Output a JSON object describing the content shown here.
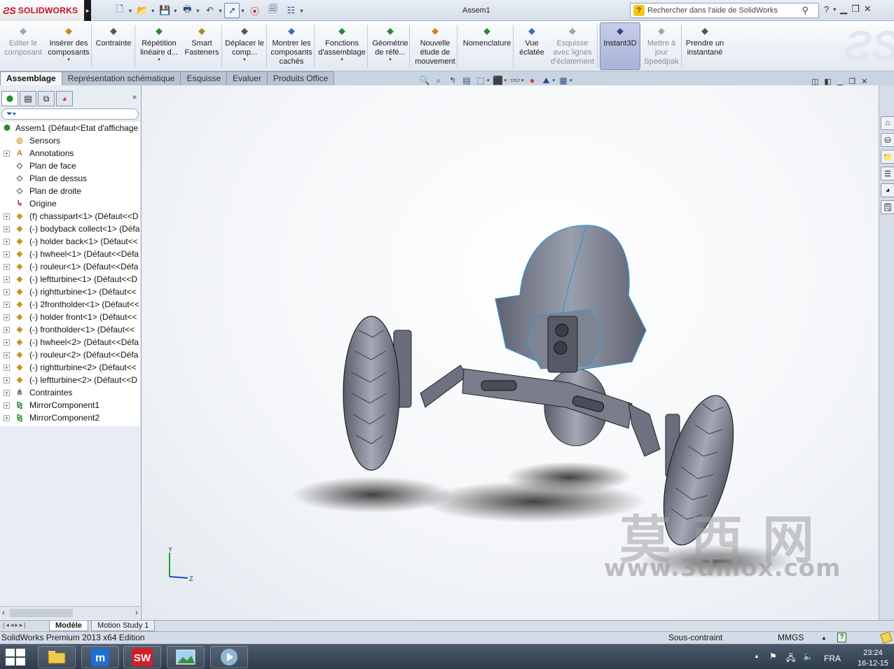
{
  "app": {
    "brand": "SOLIDWORKS",
    "doc_title": "Assem1",
    "search_placeholder": "Rechercher dans l'aide de SolidWorks"
  },
  "ribbon": {
    "items": [
      {
        "label": "Editer le composant",
        "icon": "edit-component-icon",
        "enabled": false
      },
      {
        "label": "Insérer des composants",
        "icon": "insert-components-icon",
        "enabled": true
      },
      {
        "label": "Contrainte",
        "icon": "mate-icon",
        "enabled": true
      },
      {
        "label": "Répétition linéaire d...",
        "icon": "linear-pattern-icon",
        "enabled": true
      },
      {
        "label": "Smart Fasteners",
        "icon": "smart-fasteners-icon",
        "enabled": true
      },
      {
        "label": "Déplacer le comp...",
        "icon": "move-component-icon",
        "enabled": true
      },
      {
        "label": "Montrer les composants cachés",
        "icon": "show-hidden-icon",
        "enabled": true
      },
      {
        "label": "Fonctions d'assemblage",
        "icon": "assembly-features-icon",
        "enabled": true
      },
      {
        "label": "Géométrie de réfé...",
        "icon": "reference-geometry-icon",
        "enabled": true
      },
      {
        "label": "Nouvelle étude de mouvement",
        "icon": "motion-study-icon",
        "enabled": true
      },
      {
        "label": "Nomenclature",
        "icon": "bom-icon",
        "enabled": true
      },
      {
        "label": "Vue éclatée",
        "icon": "exploded-view-icon",
        "enabled": true
      },
      {
        "label": "Esquisse avec lignes d'éclatement",
        "icon": "explode-line-sketch-icon",
        "enabled": false
      },
      {
        "label": "Instant3D",
        "icon": "instant3d-icon",
        "enabled": true,
        "active": true
      },
      {
        "label": "Mettre à jour Speedpak",
        "icon": "speedpak-icon",
        "enabled": false
      },
      {
        "label": "Prendre un instantané",
        "icon": "snapshot-icon",
        "enabled": true
      }
    ]
  },
  "command_tabs": [
    "Assemblage",
    "Représentation schématique",
    "Esquisse",
    "Evaluer",
    "Produits Office"
  ],
  "tree": {
    "root": "Assem1  (Défaut<Etat d'affichage",
    "items": [
      {
        "label": "Sensors",
        "icon": "sensor-icon",
        "expandable": false
      },
      {
        "label": "Annotations",
        "icon": "annotations-icon",
        "expandable": true
      },
      {
        "label": "Plan de face",
        "icon": "plane-icon",
        "expandable": false
      },
      {
        "label": "Plan de dessus",
        "icon": "plane-icon",
        "expandable": false
      },
      {
        "label": "Plan de droite",
        "icon": "plane-icon",
        "expandable": false
      },
      {
        "label": "Origine",
        "icon": "origin-icon",
        "expandable": false
      },
      {
        "label": "(f) chassipart<1> (Défaut<<D",
        "icon": "part-icon",
        "expandable": true
      },
      {
        "label": "(-) bodyback collect<1> (Défa",
        "icon": "part-icon",
        "expandable": true
      },
      {
        "label": "(-) holder back<1> (Défaut<<",
        "icon": "part-icon",
        "expandable": true
      },
      {
        "label": "(-) hwheel<1> (Défaut<<Défa",
        "icon": "part-icon",
        "expandable": true
      },
      {
        "label": "(-) rouleur<1> (Défaut<<Défa",
        "icon": "part-icon",
        "expandable": true
      },
      {
        "label": "(-) leftturbine<1> (Défaut<<D",
        "icon": "part-icon",
        "expandable": true
      },
      {
        "label": "(-) rightturbine<1> (Défaut<<",
        "icon": "part-icon",
        "expandable": true
      },
      {
        "label": "(-) 2frontholder<1> (Défaut<<",
        "icon": "part-icon",
        "expandable": true
      },
      {
        "label": "(-) holder front<1> (Défaut<<",
        "icon": "part-icon",
        "expandable": true
      },
      {
        "label": "(-) frontholder<1> (Défaut<<",
        "icon": "part-icon",
        "expandable": true
      },
      {
        "label": "(-) hwheel<2> (Défaut<<Défa",
        "icon": "part-icon",
        "expandable": true
      },
      {
        "label": "(-) rouleur<2> (Défaut<<Défa",
        "icon": "part-icon",
        "expandable": true
      },
      {
        "label": "(-) rightturbine<2> (Défaut<<",
        "icon": "part-icon",
        "expandable": true
      },
      {
        "label": "(-) leftturbine<2> (Défaut<<D",
        "icon": "part-icon",
        "expandable": true
      },
      {
        "label": "Contraintes",
        "icon": "mates-folder-icon",
        "expandable": true
      },
      {
        "label": "MirrorComponent1",
        "icon": "mirror-component-icon",
        "expandable": true
      },
      {
        "label": "MirrorComponent2",
        "icon": "mirror-component-icon",
        "expandable": true
      }
    ]
  },
  "triad": {
    "y": "Y",
    "z": "Z"
  },
  "watermark": {
    "cn": "莫西网",
    "url": "www.3dmox.com"
  },
  "bottom_tabs": [
    "Modèle",
    "Motion Study 1"
  ],
  "status": {
    "edition": "SolidWorks Premium 2013 x64 Edition",
    "definition": "Sous-contraint",
    "units": "MMGS"
  },
  "taskbar": {
    "apps": [
      "file-explorer-icon",
      "maxthon-icon",
      "solidworks-icon",
      "photo-viewer-icon",
      "media-player-icon"
    ],
    "language": "FRA",
    "time": "23:24",
    "date": "16-12-15"
  },
  "colors": {
    "accent": "#c8102e",
    "model": "#7e8392",
    "edges": "#2d95d6"
  }
}
